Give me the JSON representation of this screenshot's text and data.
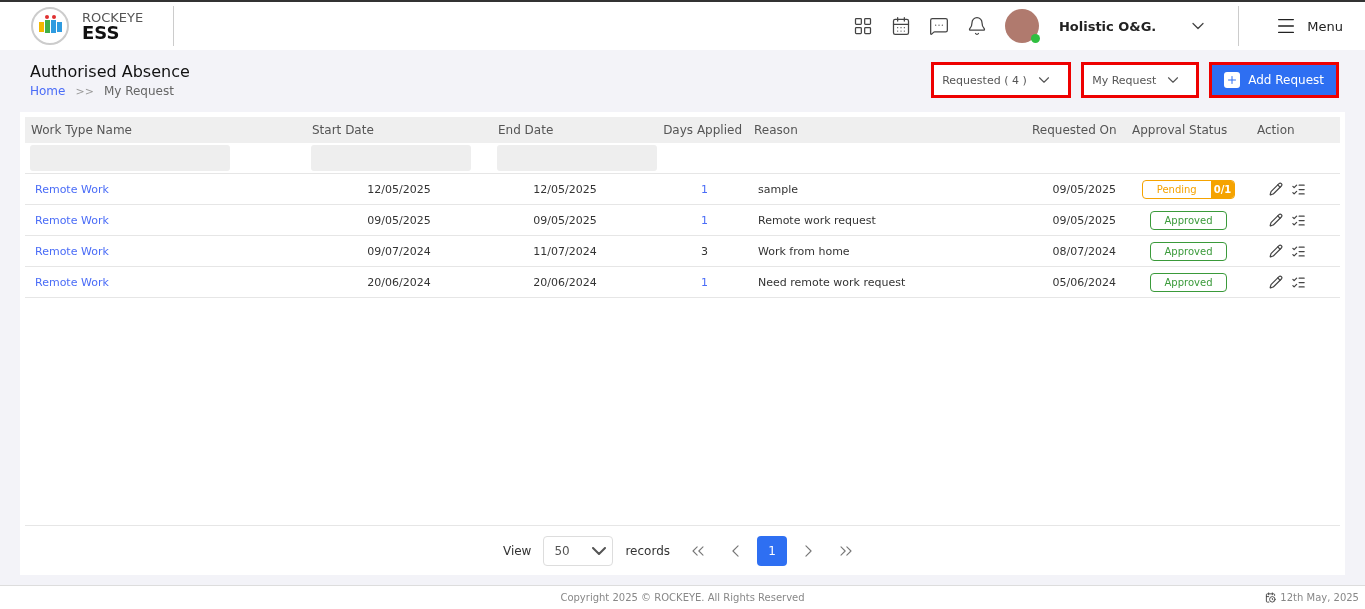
{
  "brand": {
    "top": "ROCKEYE",
    "bottom": "ESS"
  },
  "user": {
    "name": "Holistic O&G.",
    "online": true
  },
  "menu": {
    "label": "Menu"
  },
  "page": {
    "title": "Authorised Absence",
    "breadcrumb": [
      {
        "label": "Home",
        "kind": "link"
      },
      {
        "label": ">>",
        "kind": "separator"
      },
      {
        "label": "My Request",
        "kind": "current"
      }
    ]
  },
  "toolbar": {
    "status_filter": {
      "value": "Requested ( 4 )",
      "highlighted": true
    },
    "scope_filter": {
      "value": "My Request",
      "highlighted": true
    },
    "add_button": {
      "label": "Add Request",
      "highlighted": true
    }
  },
  "table": {
    "columns": [
      "Work Type Name",
      "Start Date",
      "End Date",
      "Days Applied",
      "Reason",
      "Requested On",
      "Approval Status",
      "Action"
    ],
    "rows": [
      {
        "work_type": "Remote Work",
        "start": "12/05/2025",
        "end": "12/05/2025",
        "days": "1",
        "days_link": true,
        "reason": "sample",
        "requested_on": "09/05/2025",
        "status": {
          "kind": "pending",
          "label": "Pending",
          "count": "0/1"
        }
      },
      {
        "work_type": "Remote Work",
        "start": "09/05/2025",
        "end": "09/05/2025",
        "days": "1",
        "days_link": true,
        "reason": "Remote work request",
        "requested_on": "09/05/2025",
        "status": {
          "kind": "approved",
          "label": "Approved"
        }
      },
      {
        "work_type": "Remote Work",
        "start": "09/07/2024",
        "end": "11/07/2024",
        "days": "3",
        "days_link": false,
        "reason": "Work from home",
        "requested_on": "08/07/2024",
        "status": {
          "kind": "approved",
          "label": "Approved"
        }
      },
      {
        "work_type": "Remote Work",
        "start": "20/06/2024",
        "end": "20/06/2024",
        "days": "1",
        "days_link": true,
        "reason": "Need remote work request",
        "requested_on": "05/06/2024",
        "status": {
          "kind": "approved",
          "label": "Approved"
        }
      }
    ]
  },
  "pagination": {
    "view_label": "View",
    "page_size": "50",
    "records_label": "records",
    "pages": [
      {
        "label": "1",
        "selected": true
      }
    ]
  },
  "footer": {
    "copyright": "Copyright 2025 © ROCKEYE. All Rights Reserved",
    "date": "12th May, 2025"
  }
}
